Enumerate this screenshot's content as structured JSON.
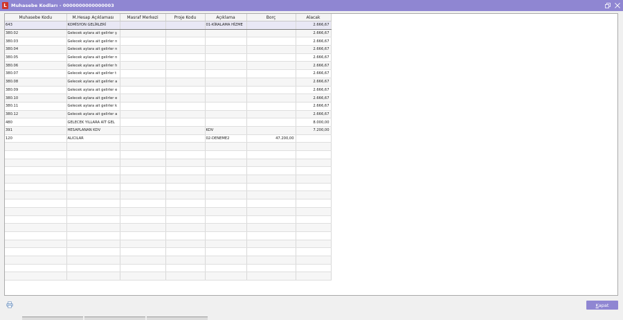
{
  "window": {
    "title": "Muhasebe Kodları - 0000000000000003"
  },
  "columns": [
    "Muhasebe  Kodu",
    "M.Hesap Açıklaması",
    "Masraf Merkezi",
    "Proje Kodu",
    "Açıklama",
    "Borç",
    "Alacak"
  ],
  "rows": [
    [
      "643",
      "KOMİSYON GELİRLERİ",
      "",
      "",
      "01-KİRALAMA HİZME",
      "",
      "2.666,67"
    ],
    [
      "380.02",
      "Gelecek aylara ait gelirler ş",
      "",
      "",
      "",
      "",
      "2.666,67"
    ],
    [
      "380.03",
      "Gelecek aylara ait gelirler n",
      "",
      "",
      "",
      "",
      "2.666,67"
    ],
    [
      "380.04",
      "Gelecek aylara ait gelirler n",
      "",
      "",
      "",
      "",
      "2.666,67"
    ],
    [
      "380.05",
      "Gelecek aylara ait gelirler n",
      "",
      "",
      "",
      "",
      "2.666,67"
    ],
    [
      "380.06",
      "Gelecek aylara ait gelirler h",
      "",
      "",
      "",
      "",
      "2.666,67"
    ],
    [
      "380.07",
      "Gelecek aylara ait gelirler t",
      "",
      "",
      "",
      "",
      "2.666,67"
    ],
    [
      "380.08",
      "Gelecek aylara ait gelirler a",
      "",
      "",
      "",
      "",
      "2.666,67"
    ],
    [
      "380.09",
      "Gelecek aylara ait gelirler e",
      "",
      "",
      "",
      "",
      "2.666,67"
    ],
    [
      "380.10",
      "Gelecek aylara ait gelirler e",
      "",
      "",
      "",
      "",
      "2.666,67"
    ],
    [
      "380.11",
      "Gelecek aylara ait gelirler k",
      "",
      "",
      "",
      "",
      "2.666,67"
    ],
    [
      "380.12",
      "Gelecek aylara ait gelirler a",
      "",
      "",
      "",
      "",
      "2.666,67"
    ],
    [
      "480",
      "GELECEK YILLARA AİT GEL",
      "",
      "",
      "",
      "",
      "8.000,00"
    ],
    [
      "391",
      "HESAPLANAN KDV",
      "",
      "",
      "KDV",
      "",
      "7.200,00"
    ],
    [
      "120",
      "ALICILAR",
      "",
      "",
      "02-DENEME2",
      "47.200,00",
      ""
    ]
  ],
  "empty_row_count": 17,
  "footer": {
    "close_label_underlined": "K",
    "close_label_rest": "apat"
  },
  "colors": {
    "titlebar": "#8f86d2",
    "selected_row": "#e9e8f5",
    "close_button": "#8f86d2"
  }
}
